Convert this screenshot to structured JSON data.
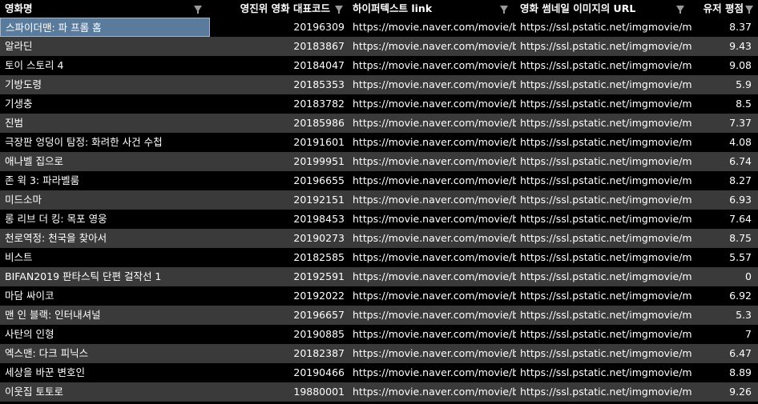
{
  "headers": [
    {
      "label": "영화명"
    },
    {
      "label": "영진위 영화 대표코드"
    },
    {
      "label": "하이퍼텍스트 link"
    },
    {
      "label": "영화 썸네일 이미지의 URL"
    },
    {
      "label": "유저 평점"
    }
  ],
  "rows": [
    {
      "title": "스파이더맨: 파 프롬 홈",
      "code": "20196309",
      "link": "https://movie.naver.com/movie/bi/m",
      "img": "https://ssl.pstatic.net/imgmovie/mdi/",
      "rating": "8.37"
    },
    {
      "title": "알라딘",
      "code": "20183867",
      "link": "https://movie.naver.com/movie/bi/m",
      "img": "https://ssl.pstatic.net/imgmovie/mdi/",
      "rating": "9.43"
    },
    {
      "title": "토이 스토리 4",
      "code": "20184047",
      "link": "https://movie.naver.com/movie/bi/m",
      "img": "https://ssl.pstatic.net/imgmovie/mdi/",
      "rating": "9.08"
    },
    {
      "title": "기방도령",
      "code": "20185353",
      "link": "https://movie.naver.com/movie/bi/m",
      "img": "https://ssl.pstatic.net/imgmovie/mdi/",
      "rating": "5.9"
    },
    {
      "title": "기생충",
      "code": "20183782",
      "link": "https://movie.naver.com/movie/bi/m",
      "img": "https://ssl.pstatic.net/imgmovie/mdi/",
      "rating": "8.5"
    },
    {
      "title": "진범",
      "code": "20185986",
      "link": "https://movie.naver.com/movie/bi/m",
      "img": "https://ssl.pstatic.net/imgmovie/mdi/",
      "rating": "7.37"
    },
    {
      "title": "극장판 엉덩이 탐정: 화려한 사건 수첩",
      "code": "20191601",
      "link": "https://movie.naver.com/movie/bi/m",
      "img": "https://ssl.pstatic.net/imgmovie/mdi/",
      "rating": "4.08"
    },
    {
      "title": "애나벨 집으로",
      "code": "20199951",
      "link": "https://movie.naver.com/movie/bi/m",
      "img": "https://ssl.pstatic.net/imgmovie/mdi/",
      "rating": "6.74"
    },
    {
      "title": "존 윅 3: 파라벨룸",
      "code": "20196655",
      "link": "https://movie.naver.com/movie/bi/m",
      "img": "https://ssl.pstatic.net/imgmovie/mdi/",
      "rating": "8.27"
    },
    {
      "title": "미드소마",
      "code": "20192151",
      "link": "https://movie.naver.com/movie/bi/m",
      "img": "https://ssl.pstatic.net/imgmovie/mdi/",
      "rating": "6.93"
    },
    {
      "title": "롱 리브 더 킹: 목포 영웅",
      "code": "20198453",
      "link": "https://movie.naver.com/movie/bi/m",
      "img": "https://ssl.pstatic.net/imgmovie/mdi/",
      "rating": "7.64"
    },
    {
      "title": "천로역정: 천국을 찾아서",
      "code": "20190273",
      "link": "https://movie.naver.com/movie/bi/m",
      "img": "https://ssl.pstatic.net/imgmovie/mdi/",
      "rating": "8.75"
    },
    {
      "title": "비스트",
      "code": "20182585",
      "link": "https://movie.naver.com/movie/bi/m",
      "img": "https://ssl.pstatic.net/imgmovie/mdi/",
      "rating": "5.57"
    },
    {
      "title": "BIFAN2019 판타스틱 단편 걸작선 1",
      "code": "20192591",
      "link": "https://movie.naver.com/movie/bi/m",
      "img": "https://ssl.pstatic.net/imgmovie/mdi/",
      "rating": "0"
    },
    {
      "title": "마담 싸이코",
      "code": "20192022",
      "link": "https://movie.naver.com/movie/bi/m",
      "img": "https://ssl.pstatic.net/imgmovie/mdi/",
      "rating": "6.92"
    },
    {
      "title": "맨 인 블랙: 인터내셔널",
      "code": "20196657",
      "link": "https://movie.naver.com/movie/bi/m",
      "img": "https://ssl.pstatic.net/imgmovie/mdi/",
      "rating": "5.3"
    },
    {
      "title": "사탄의 인형",
      "code": "20190885",
      "link": "https://movie.naver.com/movie/bi/m",
      "img": "https://ssl.pstatic.net/imgmovie/mdi/",
      "rating": "7"
    },
    {
      "title": "엑스맨: 다크 피닉스",
      "code": "20182387",
      "link": "https://movie.naver.com/movie/bi/m",
      "img": "https://ssl.pstatic.net/imgmovie/mdi/",
      "rating": "6.47"
    },
    {
      "title": "세상을 바꾼 변호인",
      "code": "20190466",
      "link": "https://movie.naver.com/movie/bi/m",
      "img": "https://ssl.pstatic.net/imgmovie/mdi/",
      "rating": "8.89"
    },
    {
      "title": "이웃집 토토로",
      "code": "19880001",
      "link": "https://movie.naver.com/movie/bi/m",
      "img": "https://ssl.pstatic.net/imgmovie/mdi/",
      "rating": "9.26"
    }
  ],
  "colors": {
    "background": "#000000",
    "band": "#3a3a3a",
    "selected": "#5b7b9c",
    "text": "#ffffff",
    "filter_icon": "#9a9a9a"
  },
  "icons": {
    "filter": "filter-icon"
  }
}
